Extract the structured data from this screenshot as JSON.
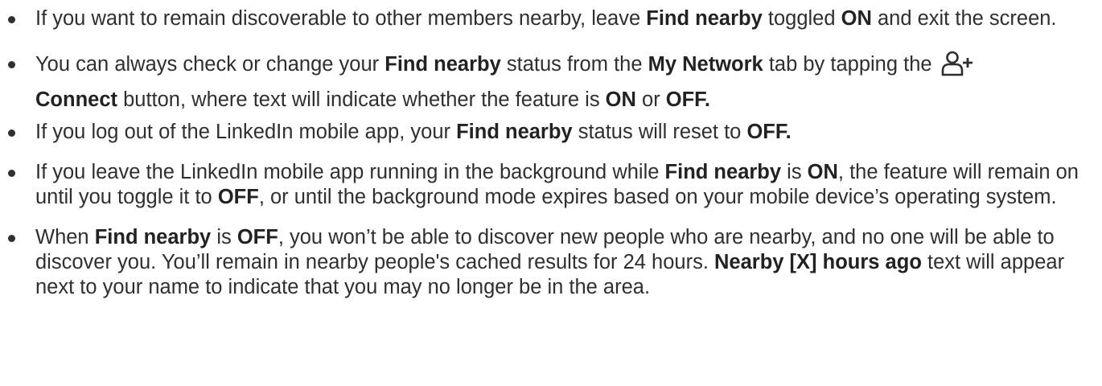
{
  "bullets": [
    {
      "t1": "If you want to remain discoverable to other members nearby, leave ",
      "b1": "Find nearby",
      "t2": " toggled ",
      "b2": "ON",
      "t3": " and exit the screen."
    },
    {
      "t1": "You can always check or change your ",
      "b1": "Find nearby",
      "t2": " status from the ",
      "b2": "My Network",
      "t3": " tab by tapping the ",
      "icon": "add-person-icon",
      "b3": "Connect",
      "t4": " button, where text will indicate whether the feature is ",
      "b4": "ON",
      "t5": " or ",
      "b5": "OFF."
    },
    {
      "t1": "If you log out of the LinkedIn mobile app, your ",
      "b1": "Find nearby",
      "t2": " status will reset to ",
      "b2": "OFF."
    },
    {
      "t1": "If you leave the LinkedIn mobile app running in the background while ",
      "b1": "Find nearby",
      "t2": " is ",
      "b2": "ON",
      "t3": ", the feature will remain on until you toggle it to ",
      "b3": "OFF",
      "t4": ", or until the background mode expires based on your mobile device’s operating system."
    },
    {
      "t1": "When ",
      "b1": "Find nearby",
      "t2": " is ",
      "b2": "OFF",
      "t3": ", you won’t be able to discover new people who are nearby, and no one will be able to discover you. You’ll remain in nearby people's cached results for 24 hours. ",
      "b3": "Nearby [X] hours ago",
      "t4": " text will appear next to your name to indicate that you may no longer be in the area."
    }
  ]
}
